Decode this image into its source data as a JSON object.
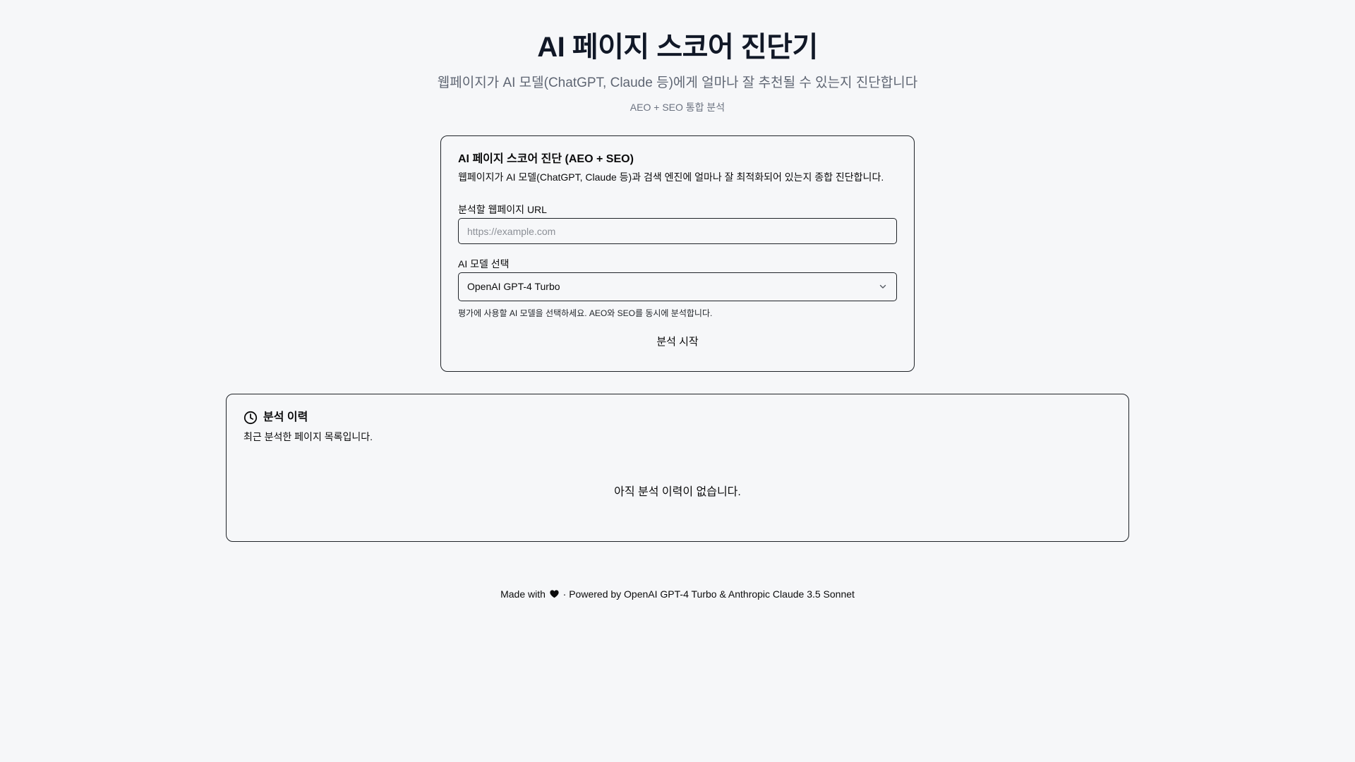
{
  "header": {
    "title": "AI 페이지 스코어 진단기",
    "subtitle": "웹페이지가 AI 모델(ChatGPT, Claude 등)에게 얼마나 잘 추천될 수 있는지 진단합니다",
    "tagline": "AEO + SEO 통합 분석"
  },
  "analyze_card": {
    "title": "AI 페이지 스코어 진단 (AEO + SEO)",
    "description": "웹페이지가 AI 모델(ChatGPT, Claude 등)과 검색 엔진에 얼마나 잘 최적화되어 있는지 종합 진단합니다.",
    "url_label": "분석할 웹페이지 URL",
    "url_value": "",
    "url_placeholder": "https://example.com",
    "model_label": "AI 모델 선택",
    "model_selected": "OpenAI GPT-4 Turbo",
    "model_hint": "평가에 사용할 AI 모델을 선택하세요. AEO와 SEO를 동시에 분석합니다.",
    "submit_label": "분석 시작"
  },
  "history_card": {
    "title": "분석 이력",
    "description": "최근 분석한 페이지 목록입니다.",
    "empty_message": "아직 분석 이력이 없습니다."
  },
  "footer": {
    "made_with": "Made with",
    "powered_by": "· Powered by OpenAI GPT-4 Turbo & Anthropic Claude 3.5 Sonnet"
  },
  "icons": {
    "history": "clock-icon",
    "select": "chevron-down-icon",
    "footer": "heart-icon"
  },
  "colors": {
    "background": "#f6f7f9",
    "title": "#111827",
    "border": "#1f2328"
  }
}
